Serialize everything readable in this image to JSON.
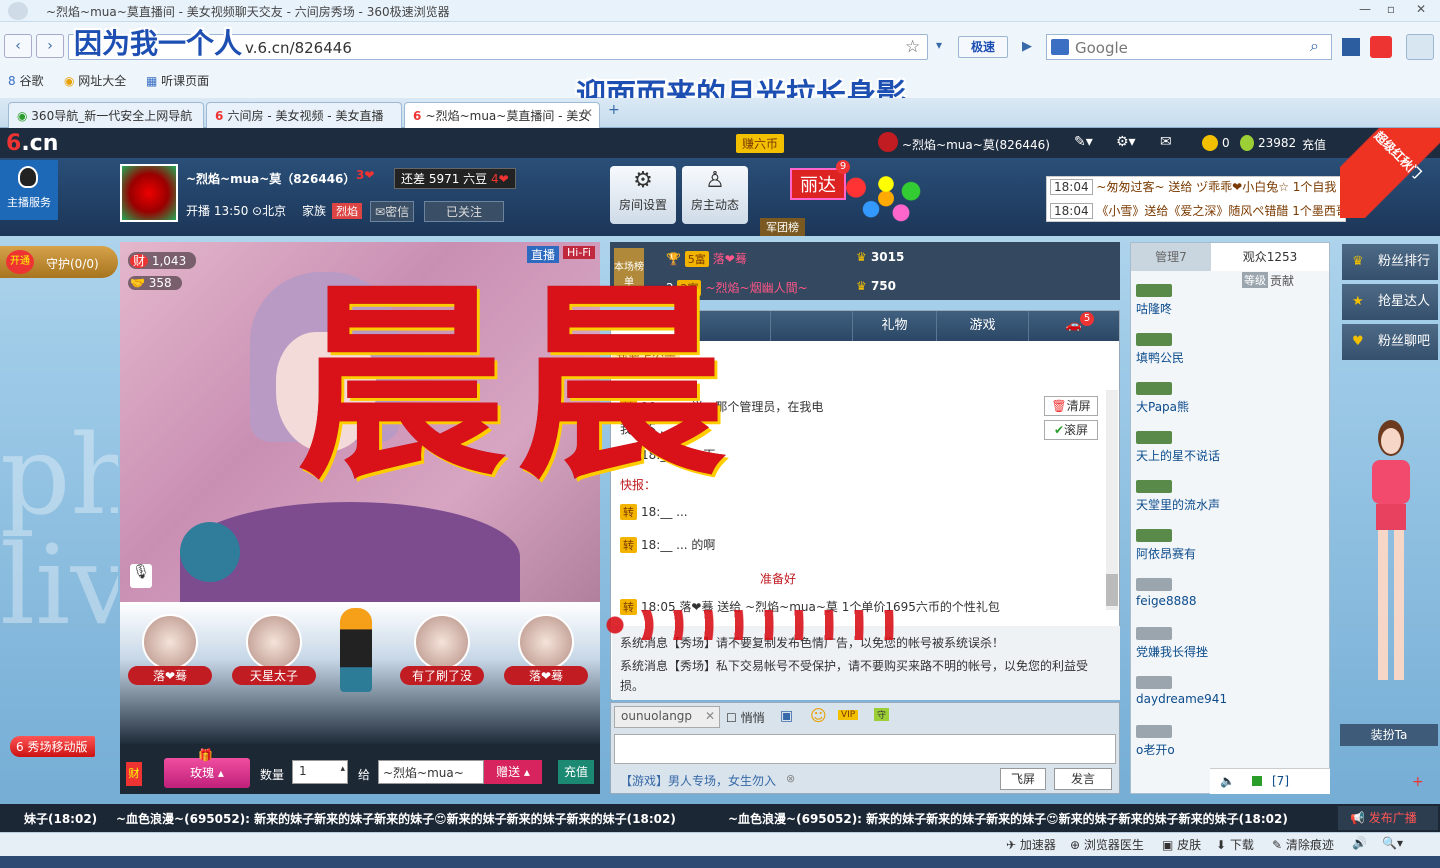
{
  "browser": {
    "title": "~烈焰~mua~莫直播间 - 美女视频聊天交友 - 六间房秀场 - 360极速浏览器",
    "url": "v.6.cn/826446",
    "overlay_line1": "因为我一个人",
    "overlay_line2": "迎面而来的月光拉长身影",
    "speed_label": "极速",
    "search_placeholder": "Google",
    "bookmarks": [
      "谷歌",
      "网址大全",
      "听课页面"
    ],
    "tabs": [
      {
        "label": "360导航_新一代安全上网导航",
        "active": false
      },
      {
        "label": "六间房 - 美女视频 - 美女直播",
        "active": false
      },
      {
        "label": "~烈焰~mua~莫直播间 - 美女",
        "active": true
      }
    ]
  },
  "site": {
    "logo_num": "6",
    "logo_cn": ".cn",
    "earn": "赚六币",
    "user": "~烈焰~mua~莫(826446)",
    "coins": "0",
    "beans": "23982",
    "recharge": "充值",
    "corner_badge": "超级红秋门"
  },
  "host": {
    "service": "主播服务",
    "name": "~烈焰~mua~莫（826446）",
    "level": "3",
    "gap": "还差 5971 六豆",
    "gap_level": "4",
    "start_time": "开播 13:50",
    "location": "北京",
    "family_label": "家族",
    "family": "烈焰",
    "message": "密信",
    "follow": "已关注",
    "btn_settings": "房间设置",
    "btn_dynamics": "房主动态",
    "balloon_name": "丽达",
    "balloon_count": "9",
    "army": "军团榜"
  },
  "news": [
    {
      "time": "18:04",
      "text": "~匆匆过客~ 送给 ヅ乖乖❤小白兔☆ 1个自我"
    },
    {
      "time": "18:04",
      "text": "《小雪》送给《爱之深》随风ぺ错醋 1个墨西哥小伙"
    }
  ],
  "left": {
    "open": "开通",
    "guard": "守护(0/0)",
    "mobile": "秀场移动版"
  },
  "video": {
    "live": "直播",
    "hifi": "Hi-Fi",
    "wealth": "1,043",
    "fans": "358"
  },
  "guests": [
    "落❤蓦",
    "天星太子",
    "有了刷了没",
    "落❤蓦"
  ],
  "giftbar": {
    "gift": "玫瑰",
    "qty_label": "数量",
    "qty": "1",
    "to_label": "给",
    "to": "~烈焰~mua~",
    "send": "赠送",
    "recharge": "充值"
  },
  "rank": {
    "label": "本场榜单",
    "rows": [
      {
        "rank": "",
        "name": "落❤蓦",
        "score": "3015"
      },
      {
        "rank": "2",
        "name": "~烈焰~烟幽人間~",
        "score": "750"
      }
    ]
  },
  "chat": {
    "tabs": [
      "全部",
      "",
      "",
      "礼物",
      "游戏",
      "5"
    ],
    "announce": "我要上公告",
    "clear": "清屏",
    "scroll": "滚屏",
    "messages": [
      "18:__ ... 说：那个管理员，在我电",
      "我棚不 ...",
      "18:__ ... 一下",
      "快报：",
      "18:__ ...",
      "18:__ ... 的啊",
      "准备好",
      "18:05 落❤蓦 送给 ~烈焰~mua~莫 1个单价1695六币的个性礼包"
    ],
    "sys1": "系统消息【秀场】请不要复制发布色情广告，以免您的帐号被系统误杀！",
    "sys2": "系统消息【秀场】私下交易帐号不受保护，请不要购买来路不明的帐号，以免您的利益受损。",
    "input_user": "ounuolangp",
    "whisper": "悄悄",
    "game_tip": "【游戏】男人专场，女生勿入",
    "fly": "飞屏",
    "send": "发言"
  },
  "audience": {
    "tab_admin": "管理7",
    "tab_viewers": "观众1253",
    "sub_level": "等级",
    "sub_contrib": "贡献",
    "list": [
      "咕隆咚",
      "填鸭公民",
      "大Papa熊",
      "天上的星不说话",
      "天堂里的流水声",
      "阿依昂赛有",
      "feige8888",
      "党嫌我长得挫",
      "daydreame941",
      "o老开o"
    ],
    "footer": "[7]"
  },
  "widgets": {
    "fans_rank": "粉丝排行",
    "star": "抢星达人",
    "bar": "粉丝聊吧",
    "dress": "装扮Ta"
  },
  "ticker": {
    "items": [
      "妹子(18:02)",
      "~血色浪漫~(695052): 新来的妹子新来的妹子新来的妹子😍新来的妹子新来的妹子新来的妹子(18:02)",
      "~血色浪漫~(695052): 新来的妹子新来的妹子新来的妹子😍新来的妹子新来的妹子新来的妹子(18:02)"
    ],
    "broadcast": "发布广播"
  },
  "statusbar": [
    "加速器",
    "浏览器医生",
    "皮肤",
    "下载",
    "清除痕迹"
  ],
  "overlay_text": "晨晨"
}
